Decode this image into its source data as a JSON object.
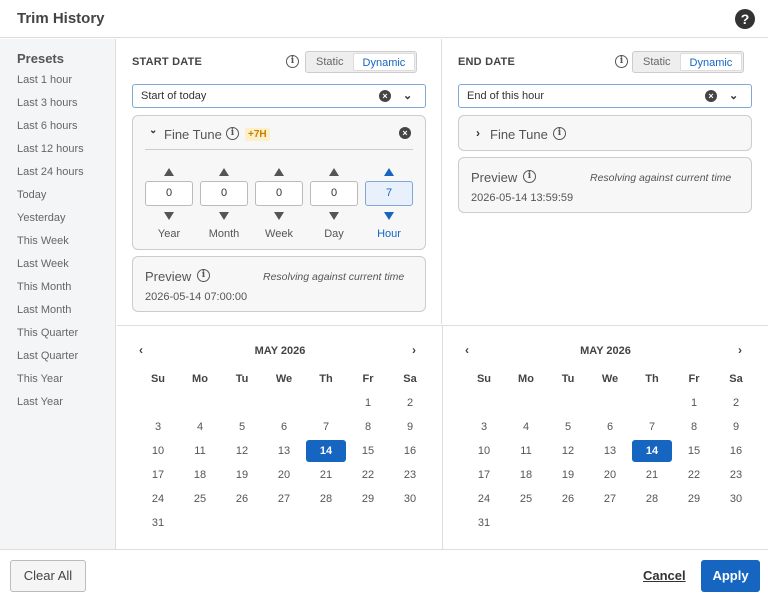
{
  "window": {
    "title": "Trim History"
  },
  "sidebar": {
    "title": "Presets",
    "items": [
      "Last 1 hour",
      "Last 3 hours",
      "Last 6 hours",
      "Last 12 hours",
      "Last 24 hours",
      "Today",
      "Yesterday",
      "This Week",
      "Last Week",
      "This Month",
      "Last Month",
      "This Quarter",
      "Last Quarter",
      "This Year",
      "Last Year"
    ]
  },
  "start": {
    "heading": "START DATE",
    "mode_static": "Static",
    "mode_dynamic": "Dynamic",
    "active_mode": "Dynamic",
    "select_value": "Start of today",
    "fine_tune": {
      "label": "Fine Tune",
      "expanded": true,
      "badge": "+7H",
      "units": [
        {
          "label": "Year",
          "value": "0"
        },
        {
          "label": "Month",
          "value": "0"
        },
        {
          "label": "Week",
          "value": "0"
        },
        {
          "label": "Day",
          "value": "0"
        },
        {
          "label": "Hour",
          "value": "7"
        }
      ],
      "active_unit": "Hour"
    },
    "preview": {
      "title": "Preview",
      "note": "Resolving against current time",
      "value": "2026-05-14 07:00:00"
    }
  },
  "end": {
    "heading": "END DATE",
    "mode_static": "Static",
    "mode_dynamic": "Dynamic",
    "active_mode": "Dynamic",
    "select_value": "End of this hour",
    "fine_tune": {
      "label": "Fine Tune",
      "expanded": false
    },
    "preview": {
      "title": "Preview",
      "note": "Resolving against current time",
      "value": "2026-05-14 13:59:59"
    }
  },
  "calendar": {
    "month_label": "MAY 2026",
    "prev": "‹",
    "next": "›",
    "weekdays": [
      "Su",
      "Mo",
      "Tu",
      "We",
      "Th",
      "Fr",
      "Sa"
    ],
    "first_weekday": 5,
    "days_in_month": 31,
    "selected_day": 14
  },
  "footer": {
    "clear": "Clear All",
    "cancel": "Cancel",
    "apply": "Apply"
  },
  "colors": {
    "accent": "#1665c1",
    "badge": "#c97e00"
  }
}
